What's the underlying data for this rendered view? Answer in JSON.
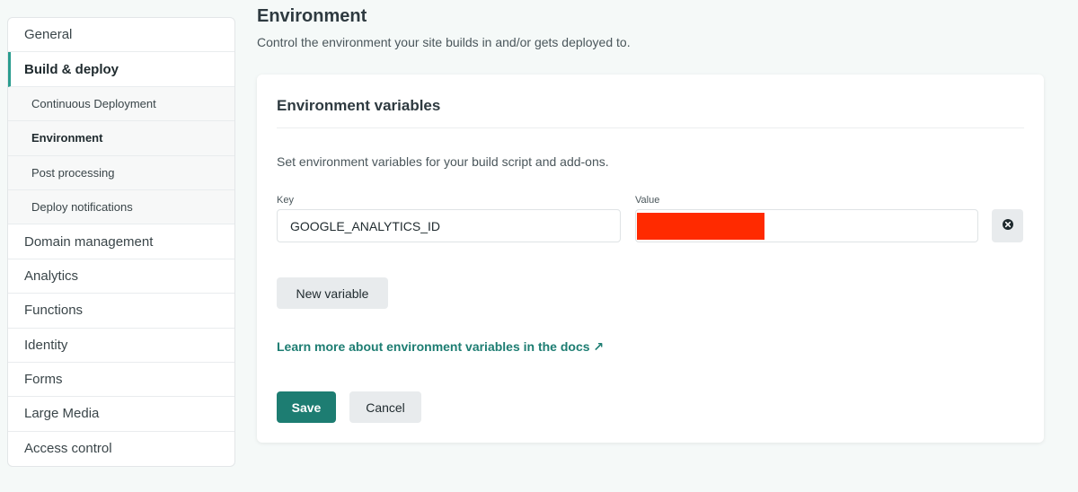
{
  "sidebar": {
    "items": [
      {
        "label": "General"
      },
      {
        "label": "Build & deploy"
      },
      {
        "label": "Domain management"
      },
      {
        "label": "Analytics"
      },
      {
        "label": "Functions"
      },
      {
        "label": "Identity"
      },
      {
        "label": "Forms"
      },
      {
        "label": "Large Media"
      },
      {
        "label": "Access control"
      }
    ],
    "subitems": [
      {
        "label": "Continuous Deployment"
      },
      {
        "label": "Environment"
      },
      {
        "label": "Post processing"
      },
      {
        "label": "Deploy notifications"
      }
    ]
  },
  "page": {
    "title": "Environment",
    "description": "Control the environment your site builds in and/or gets deployed to."
  },
  "card": {
    "title": "Environment variables",
    "description": "Set environment variables for your build script and add-ons.",
    "key_label": "Key",
    "value_label": "Value",
    "key_value": "GOOGLE_ANALYTICS_ID",
    "value_value": "",
    "new_variable_label": "New variable",
    "docs_link": "Learn more about environment variables in the docs ↗",
    "save_label": "Save",
    "cancel_label": "Cancel"
  },
  "colors": {
    "accent": "#1d7d72",
    "link": "#1d7d72",
    "redaction": "#ff2a00",
    "background": "#f5f9f8"
  },
  "icons": {
    "remove": "close-circle-icon",
    "external": "external-link-icon"
  }
}
